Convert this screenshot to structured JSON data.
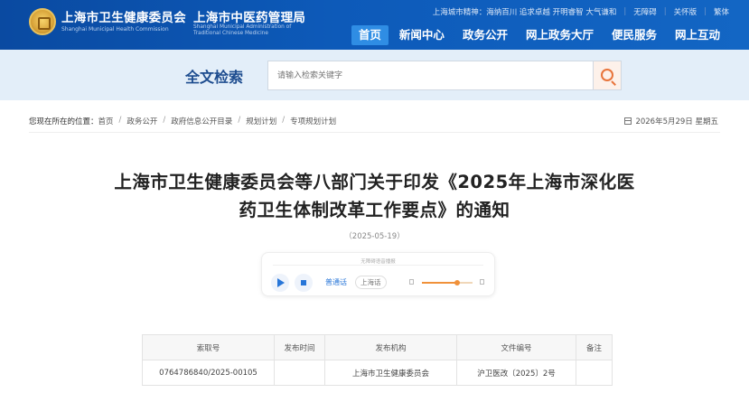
{
  "header": {
    "org1": "上海市卫生健康委员会",
    "org1_en": "Shanghai Municipal Health Commission",
    "org2": "上海市中医药管理局",
    "org2_en": "Shanghai Municipal Administration of Traditional Chinese Medicine",
    "spirit": "上海城市精神：海纳百川 追求卓越 开明睿智 大气谦和",
    "links": [
      "无障碍",
      "关怀版",
      "繁体"
    ],
    "nav": [
      "首页",
      "新闻中心",
      "政务公开",
      "网上政务大厅",
      "便民服务",
      "网上互动"
    ],
    "active_nav": "首页"
  },
  "search": {
    "title": "全文检索",
    "placeholder": "请输入检索关键字",
    "button_icon": "search-icon"
  },
  "breadcrumb": {
    "label": "您现在所在的位置：",
    "items": [
      "首页",
      "政务公开",
      "政府信息公开目录",
      "规划计划",
      "专项规划计划"
    ]
  },
  "date": "2026年5月29日 星期五",
  "article": {
    "title_line1": "上海市卫生健康委员会等八部门关于印发《2025年上海市深化医",
    "title_line2": "药卫生体制改革工作要点》的通知",
    "pub_date": "（2025-05-19）"
  },
  "player": {
    "caption": "无障碍语音播报",
    "lang_mandarin": "普通话",
    "lang_shanghai": "上海话",
    "volume_level": 0.7,
    "accent_color": "#2876d8"
  },
  "info_table": {
    "headers": [
      "索取号",
      "发布时间",
      "发布机构",
      "文件编号",
      "备注"
    ],
    "row": [
      "0764786840/2025-00105",
      "",
      "上海市卫生健康委员会",
      "沪卫医改〔2025〕2号",
      ""
    ]
  },
  "colors": {
    "header_blue": "#0d5ab9",
    "nav_active": "#2f8de4",
    "search_band": "#e3eef9",
    "search_accent": "#e8743b"
  }
}
